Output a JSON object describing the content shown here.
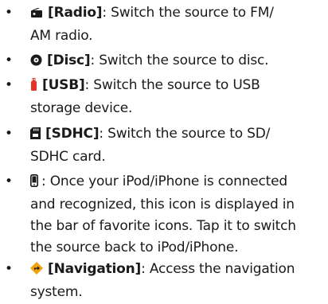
{
  "items": [
    {
      "icon": "radio-icon",
      "label": "[Radio]",
      "desc_line1": ": Switch the source to FM/",
      "desc_line2": "AM radio."
    },
    {
      "icon": "disc-icon",
      "label": "[Disc]",
      "desc_line1": ": Switch the source to disc."
    },
    {
      "icon": "usb-icon",
      "label": "[USB]",
      "desc_line1": ": Switch the source to USB",
      "desc_line2": "storage device."
    },
    {
      "icon": "sd-card-icon",
      "label": "[SDHC]",
      "desc_line1": ": Switch the source to SD/",
      "desc_line2": "SDHC card."
    },
    {
      "icon": "ipod-icon",
      "desc_line1": ": Once your iPod/iPhone is connected",
      "desc_line2": "and recognized, this icon is displayed in",
      "desc_line3": "the bar of favorite icons. Tap it to switch",
      "desc_line4": "the source back to iPod/iPhone."
    },
    {
      "icon": "navigation-icon",
      "label": "[Navigation]",
      "desc_line1": ": Access the navigation",
      "desc_line2": "system."
    }
  ],
  "bullet_char": "•"
}
